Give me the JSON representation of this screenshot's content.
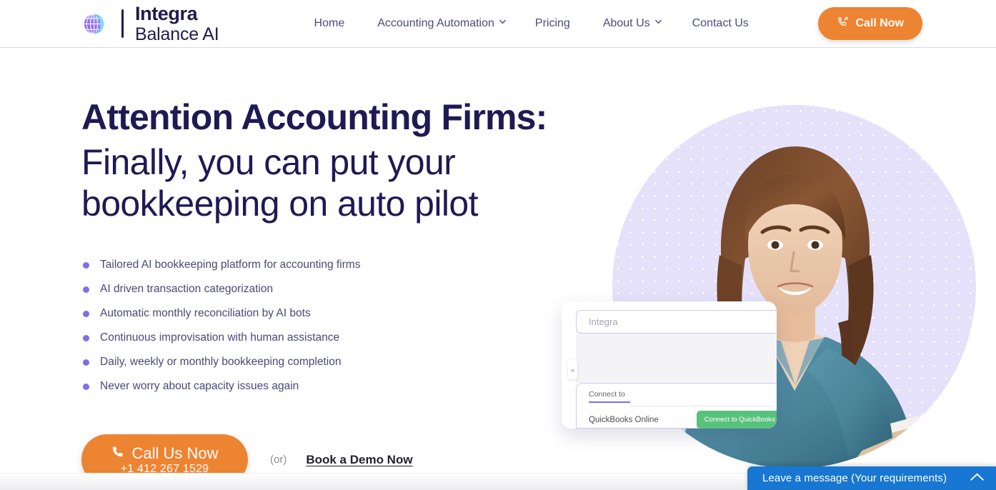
{
  "brand": {
    "logo_icon": "globe-icon",
    "name_line1": "Integra",
    "name_line2": "Balance AI"
  },
  "header": {
    "nav": [
      {
        "label": "Home",
        "has_dropdown": false,
        "name": "home"
      },
      {
        "label": "Accounting Automation",
        "has_dropdown": true,
        "name": "accounting-automation"
      },
      {
        "label": "Pricing",
        "has_dropdown": false,
        "name": "pricing"
      },
      {
        "label": "About Us",
        "has_dropdown": true,
        "name": "about-us"
      },
      {
        "label": "Contact Us",
        "has_dropdown": false,
        "name": "contact-us"
      }
    ],
    "cta": {
      "label": "Call Now",
      "icon": "phone-outgoing-icon",
      "color": "#ed8432"
    }
  },
  "hero": {
    "heading_bold": "Attention Accounting Firms:",
    "heading_regular": "Finally, you can put your bookkeeping on auto pilot",
    "bullets": [
      "Tailored AI bookkeeping platform for accounting firms",
      "AI driven transaction categorization",
      "Automatic monthly reconciliation by AI bots",
      "Continuous improvisation with human assistance",
      "Daily, weekly or monthly bookkeeping completion",
      "Never worry about capacity issues again"
    ],
    "bullet_color": "#7b6ef0",
    "cta": {
      "primary_label": "Call Us Now",
      "primary_phone": "+1 412 267 1529",
      "primary_icon": "phone-icon",
      "separator": "(or)",
      "secondary_label": "Book a Demo Now"
    },
    "image": {
      "alt": "smiling-woman-holding-clipboard",
      "circle_color": "#e5e1fa",
      "dot_color": "#ffffff"
    },
    "mockup": {
      "field_placeholder": "Integra",
      "connect_label": "Connect to",
      "provider": "QuickBooks Online",
      "connect_button": "Connect to QuickBooks",
      "connect_button_color": "#58c27d",
      "collapse_icon": "chevron-left-icon"
    }
  },
  "chat_widget": {
    "label": "Leave a message (Your requirements)",
    "toggle_icon": "chevron-up-icon",
    "color": "#1877d2"
  }
}
